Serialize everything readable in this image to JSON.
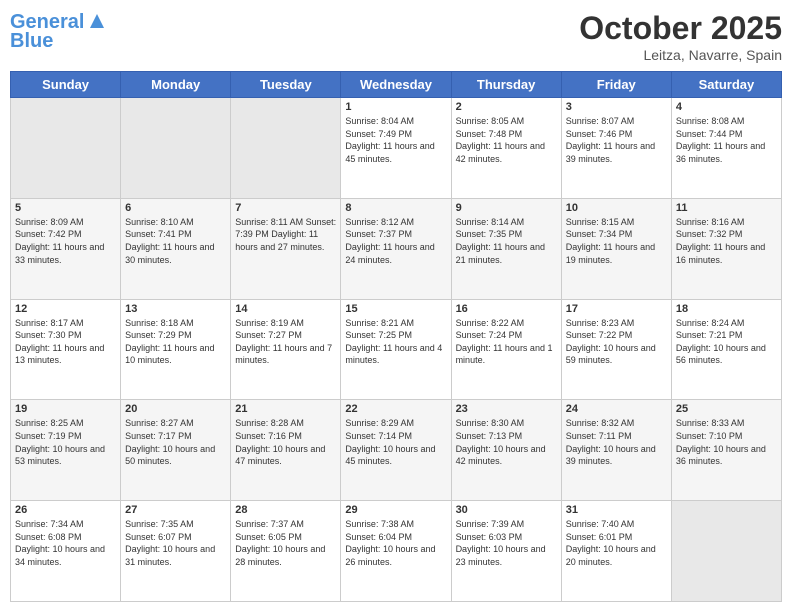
{
  "header": {
    "logo_line1": "General",
    "logo_line2": "Blue",
    "month": "October 2025",
    "location": "Leitza, Navarre, Spain"
  },
  "weekdays": [
    "Sunday",
    "Monday",
    "Tuesday",
    "Wednesday",
    "Thursday",
    "Friday",
    "Saturday"
  ],
  "weeks": [
    [
      {
        "day": "",
        "info": ""
      },
      {
        "day": "",
        "info": ""
      },
      {
        "day": "",
        "info": ""
      },
      {
        "day": "1",
        "info": "Sunrise: 8:04 AM\nSunset: 7:49 PM\nDaylight: 11 hours\nand 45 minutes."
      },
      {
        "day": "2",
        "info": "Sunrise: 8:05 AM\nSunset: 7:48 PM\nDaylight: 11 hours\nand 42 minutes."
      },
      {
        "day": "3",
        "info": "Sunrise: 8:07 AM\nSunset: 7:46 PM\nDaylight: 11 hours\nand 39 minutes."
      },
      {
        "day": "4",
        "info": "Sunrise: 8:08 AM\nSunset: 7:44 PM\nDaylight: 11 hours\nand 36 minutes."
      }
    ],
    [
      {
        "day": "5",
        "info": "Sunrise: 8:09 AM\nSunset: 7:42 PM\nDaylight: 11 hours\nand 33 minutes."
      },
      {
        "day": "6",
        "info": "Sunrise: 8:10 AM\nSunset: 7:41 PM\nDaylight: 11 hours\nand 30 minutes."
      },
      {
        "day": "7",
        "info": "Sunrise: 8:11 AM\nSunset: 7:39 PM\nDaylight: 11 hours\nand 27 minutes."
      },
      {
        "day": "8",
        "info": "Sunrise: 8:12 AM\nSunset: 7:37 PM\nDaylight: 11 hours\nand 24 minutes."
      },
      {
        "day": "9",
        "info": "Sunrise: 8:14 AM\nSunset: 7:35 PM\nDaylight: 11 hours\nand 21 minutes."
      },
      {
        "day": "10",
        "info": "Sunrise: 8:15 AM\nSunset: 7:34 PM\nDaylight: 11 hours\nand 19 minutes."
      },
      {
        "day": "11",
        "info": "Sunrise: 8:16 AM\nSunset: 7:32 PM\nDaylight: 11 hours\nand 16 minutes."
      }
    ],
    [
      {
        "day": "12",
        "info": "Sunrise: 8:17 AM\nSunset: 7:30 PM\nDaylight: 11 hours\nand 13 minutes."
      },
      {
        "day": "13",
        "info": "Sunrise: 8:18 AM\nSunset: 7:29 PM\nDaylight: 11 hours\nand 10 minutes."
      },
      {
        "day": "14",
        "info": "Sunrise: 8:19 AM\nSunset: 7:27 PM\nDaylight: 11 hours\nand 7 minutes."
      },
      {
        "day": "15",
        "info": "Sunrise: 8:21 AM\nSunset: 7:25 PM\nDaylight: 11 hours\nand 4 minutes."
      },
      {
        "day": "16",
        "info": "Sunrise: 8:22 AM\nSunset: 7:24 PM\nDaylight: 11 hours\nand 1 minute."
      },
      {
        "day": "17",
        "info": "Sunrise: 8:23 AM\nSunset: 7:22 PM\nDaylight: 10 hours\nand 59 minutes."
      },
      {
        "day": "18",
        "info": "Sunrise: 8:24 AM\nSunset: 7:21 PM\nDaylight: 10 hours\nand 56 minutes."
      }
    ],
    [
      {
        "day": "19",
        "info": "Sunrise: 8:25 AM\nSunset: 7:19 PM\nDaylight: 10 hours\nand 53 minutes."
      },
      {
        "day": "20",
        "info": "Sunrise: 8:27 AM\nSunset: 7:17 PM\nDaylight: 10 hours\nand 50 minutes."
      },
      {
        "day": "21",
        "info": "Sunrise: 8:28 AM\nSunset: 7:16 PM\nDaylight: 10 hours\nand 47 minutes."
      },
      {
        "day": "22",
        "info": "Sunrise: 8:29 AM\nSunset: 7:14 PM\nDaylight: 10 hours\nand 45 minutes."
      },
      {
        "day": "23",
        "info": "Sunrise: 8:30 AM\nSunset: 7:13 PM\nDaylight: 10 hours\nand 42 minutes."
      },
      {
        "day": "24",
        "info": "Sunrise: 8:32 AM\nSunset: 7:11 PM\nDaylight: 10 hours\nand 39 minutes."
      },
      {
        "day": "25",
        "info": "Sunrise: 8:33 AM\nSunset: 7:10 PM\nDaylight: 10 hours\nand 36 minutes."
      }
    ],
    [
      {
        "day": "26",
        "info": "Sunrise: 7:34 AM\nSunset: 6:08 PM\nDaylight: 10 hours\nand 34 minutes."
      },
      {
        "day": "27",
        "info": "Sunrise: 7:35 AM\nSunset: 6:07 PM\nDaylight: 10 hours\nand 31 minutes."
      },
      {
        "day": "28",
        "info": "Sunrise: 7:37 AM\nSunset: 6:05 PM\nDaylight: 10 hours\nand 28 minutes."
      },
      {
        "day": "29",
        "info": "Sunrise: 7:38 AM\nSunset: 6:04 PM\nDaylight: 10 hours\nand 26 minutes."
      },
      {
        "day": "30",
        "info": "Sunrise: 7:39 AM\nSunset: 6:03 PM\nDaylight: 10 hours\nand 23 minutes."
      },
      {
        "day": "31",
        "info": "Sunrise: 7:40 AM\nSunset: 6:01 PM\nDaylight: 10 hours\nand 20 minutes."
      },
      {
        "day": "",
        "info": ""
      }
    ]
  ]
}
